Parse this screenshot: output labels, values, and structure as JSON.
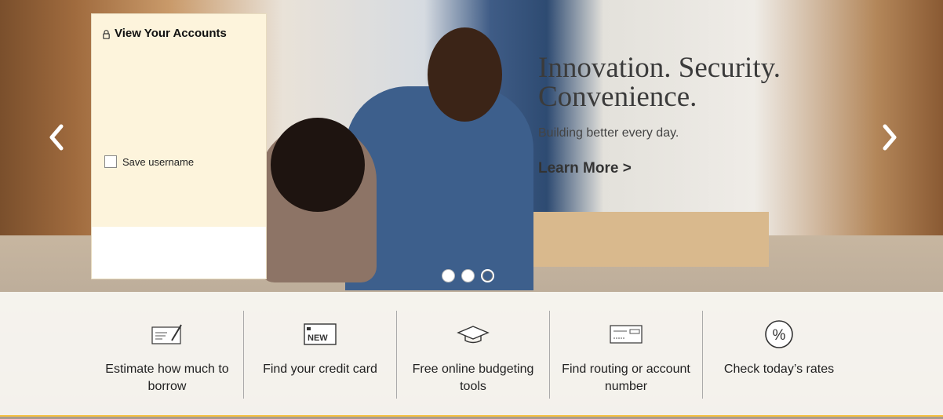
{
  "login": {
    "title": "View Your Accounts",
    "save_username_label": "Save username"
  },
  "hero": {
    "headline_line1": "Innovation. Security.",
    "headline_line2": "Convenience.",
    "subtitle": "Building better every day.",
    "cta": "Learn More >"
  },
  "carousel": {
    "slide_count": 3,
    "active_index": 2
  },
  "quick_links": [
    {
      "label": "Estimate how much to borrow",
      "icon": "check-writing-icon"
    },
    {
      "label": "Find your credit card",
      "icon": "new-card-icon"
    },
    {
      "label": "Free online budgeting tools",
      "icon": "graduation-cap-icon"
    },
    {
      "label": "Find routing or account number",
      "icon": "check-icon"
    },
    {
      "label": "Check today’s rates",
      "icon": "percent-circle-icon"
    }
  ],
  "colors": {
    "accent_gold": "#f5c244",
    "login_panel_bg": "#fdf4dc"
  }
}
